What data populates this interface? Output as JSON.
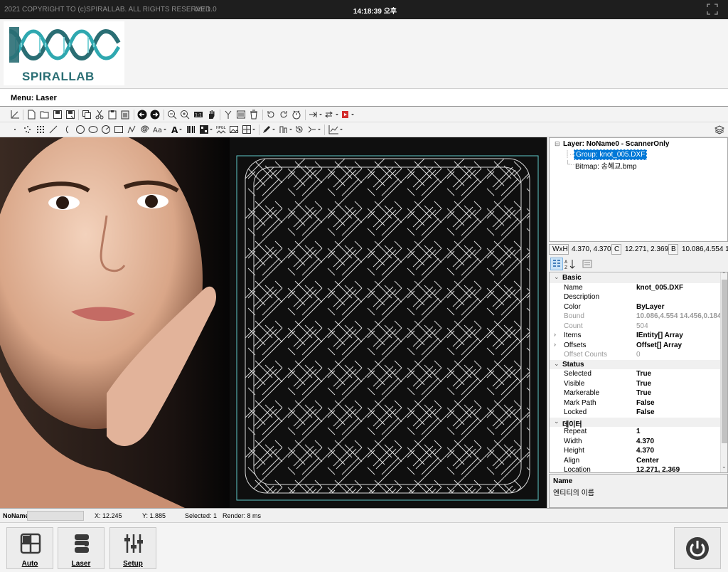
{
  "titlebar": {
    "copyright": "2021 COPYRIGHT TO (c)SPIRALLAB. ALL RIGHTS RESERVED.",
    "version": "Ver 1.0",
    "clock": "14:18:39 오후",
    "fullscreen_icon": "fullscreen-icon"
  },
  "logo": {
    "text": "SPIRALLAB"
  },
  "menu": {
    "label": "Menu: Laser"
  },
  "tree": {
    "layer": "Layer: NoName0 - ScannerOnly",
    "group": "Group: knot_005.DXF",
    "bitmap": "Bitmap: 송혜교.bmp"
  },
  "infobar": {
    "wxh_label": "WxH",
    "wxh_value": "4.370, 4.370",
    "c_label": "C",
    "c_value": "12.271, 2.369",
    "b_label": "B",
    "b_value": "10.086,4.554 1"
  },
  "properties": {
    "categories": {
      "basic": "Basic",
      "status": "Status",
      "data": "데이터"
    },
    "rows": {
      "name": {
        "label": "Name",
        "value": "knot_005.DXF"
      },
      "description": {
        "label": "Description",
        "value": ""
      },
      "color": {
        "label": "Color",
        "value": "ByLayer"
      },
      "bound": {
        "label": "Bound",
        "value": "10.086,4.554 14.456,0.184"
      },
      "count": {
        "label": "Count",
        "value": "504"
      },
      "items": {
        "label": "Items",
        "value": "IEntity[] Array"
      },
      "offsets": {
        "label": "Offsets",
        "value": "Offset[] Array"
      },
      "offset_counts": {
        "label": "Offset Counts",
        "value": "0"
      },
      "selected": {
        "label": "Selected",
        "value": "True"
      },
      "visible": {
        "label": "Visible",
        "value": "True"
      },
      "markerable": {
        "label": "Markerable",
        "value": "True"
      },
      "mark_path": {
        "label": "Mark Path",
        "value": "False"
      },
      "locked": {
        "label": "Locked",
        "value": "False"
      },
      "repeat": {
        "label": "Repeat",
        "value": "1"
      },
      "width": {
        "label": "Width",
        "value": "4.370"
      },
      "height": {
        "label": "Height",
        "value": "4.370"
      },
      "align": {
        "label": "Align",
        "value": "Center"
      },
      "location": {
        "label": "Location",
        "value": "12.271, 2.369"
      }
    }
  },
  "description_panel": {
    "title": "Name",
    "text": "엔티티의 이름"
  },
  "statusbar": {
    "name": "NoName",
    "x": "X: 12.245",
    "y": "Y: 1.885",
    "selected": "Selected: 1",
    "render": "Render: 8 ms"
  },
  "bottom": {
    "auto": "Auto",
    "laser": "Laser",
    "setup": "Setup"
  },
  "colors": {
    "titlebar_bg": "#1e1e1e",
    "canvas_bg": "#0e0e0e",
    "selection": "#0078d7",
    "brand": "#2a6e74",
    "knot_stroke": "#d8d8d8",
    "frame_stroke": "#5fc8c8"
  }
}
